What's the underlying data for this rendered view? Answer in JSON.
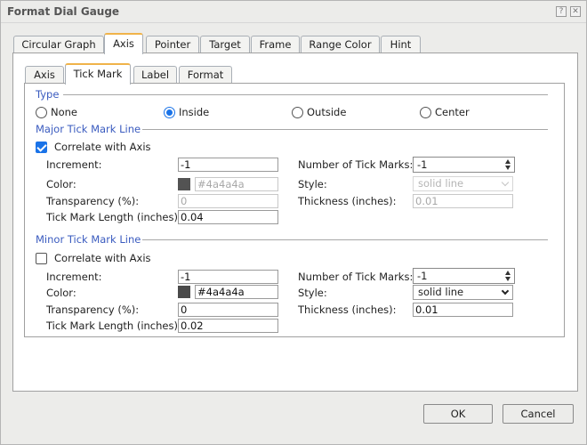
{
  "window": {
    "title": "Format Dial Gauge",
    "help_icon": "?",
    "close_icon": "✕"
  },
  "tabs": [
    {
      "label": "Circular Graph",
      "active": false
    },
    {
      "label": "Axis",
      "active": true
    },
    {
      "label": "Pointer",
      "active": false
    },
    {
      "label": "Target",
      "active": false
    },
    {
      "label": "Frame",
      "active": false
    },
    {
      "label": "Range Color",
      "active": false
    },
    {
      "label": "Hint",
      "active": false
    }
  ],
  "subtabs": [
    {
      "label": "Axis",
      "active": false
    },
    {
      "label": "Tick Mark",
      "active": true
    },
    {
      "label": "Label",
      "active": false
    },
    {
      "label": "Format",
      "active": false
    }
  ],
  "type": {
    "title": "Type",
    "options": [
      {
        "label": "None",
        "checked": false
      },
      {
        "label": "Inside",
        "checked": true
      },
      {
        "label": "Outside",
        "checked": false
      },
      {
        "label": "Center",
        "checked": false
      }
    ]
  },
  "major": {
    "title": "Major Tick Mark Line",
    "correlate_label": "Correlate with Axis",
    "correlate_checked": true,
    "increment_label": "Increment:",
    "increment_value": "-1",
    "color_label": "Color:",
    "color_value": "#4a4a4a",
    "transparency_label": "Transparency (%):",
    "transparency_value": "0",
    "length_label": "Tick Mark Length (inches):",
    "length_value": "0.04",
    "num_ticks_label": "Number of Tick Marks:",
    "num_ticks_value": "-1",
    "style_label": "Style:",
    "style_value": "solid line",
    "thickness_label": "Thickness (inches):",
    "thickness_value": "0.01"
  },
  "minor": {
    "title": "Minor Tick Mark Line",
    "correlate_label": "Correlate with Axis",
    "correlate_checked": false,
    "increment_label": "Increment:",
    "increment_value": "-1",
    "color_label": "Color:",
    "color_value": "#4a4a4a",
    "transparency_label": "Transparency (%):",
    "transparency_value": "0",
    "length_label": "Tick Mark Length (inches):",
    "length_value": "0.02",
    "num_ticks_label": "Number of Tick Marks:",
    "num_ticks_value": "-1",
    "style_label": "Style:",
    "style_value": "solid line",
    "thickness_label": "Thickness (inches):",
    "thickness_value": "0.01"
  },
  "buttons": {
    "ok": "OK",
    "cancel": "Cancel"
  }
}
